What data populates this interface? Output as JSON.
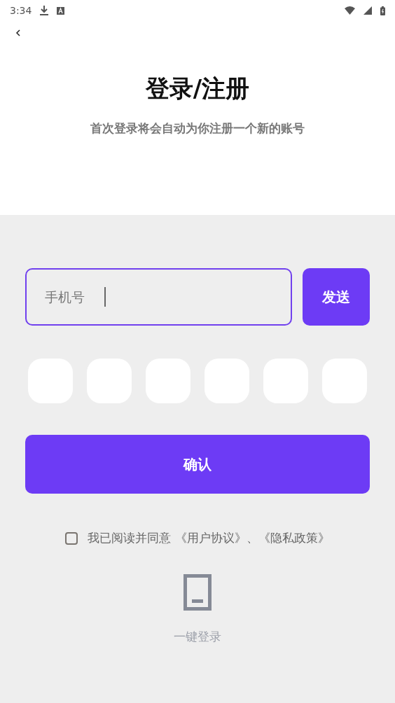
{
  "status_bar": {
    "time": "3:34"
  },
  "header": {
    "title": "登录/注册",
    "subtitle": "首次登录将会自动为你注册一个新的账号"
  },
  "phone_field": {
    "placeholder": "手机号",
    "focused": true
  },
  "send_button": {
    "label": "发送"
  },
  "code_boxes": [
    {
      "kind": "empty"
    },
    {
      "kind": "empty"
    },
    {
      "kind": "empty"
    },
    {
      "kind": "empty"
    },
    {
      "kind": "empty"
    },
    {
      "kind": "empty"
    }
  ],
  "confirm_button": {
    "label": "确认"
  },
  "agreement": {
    "checked": false,
    "text": "我已阅读并同意 《用户协议》、《隐私政策》"
  },
  "quick_login": {
    "label": "一键登录"
  }
}
